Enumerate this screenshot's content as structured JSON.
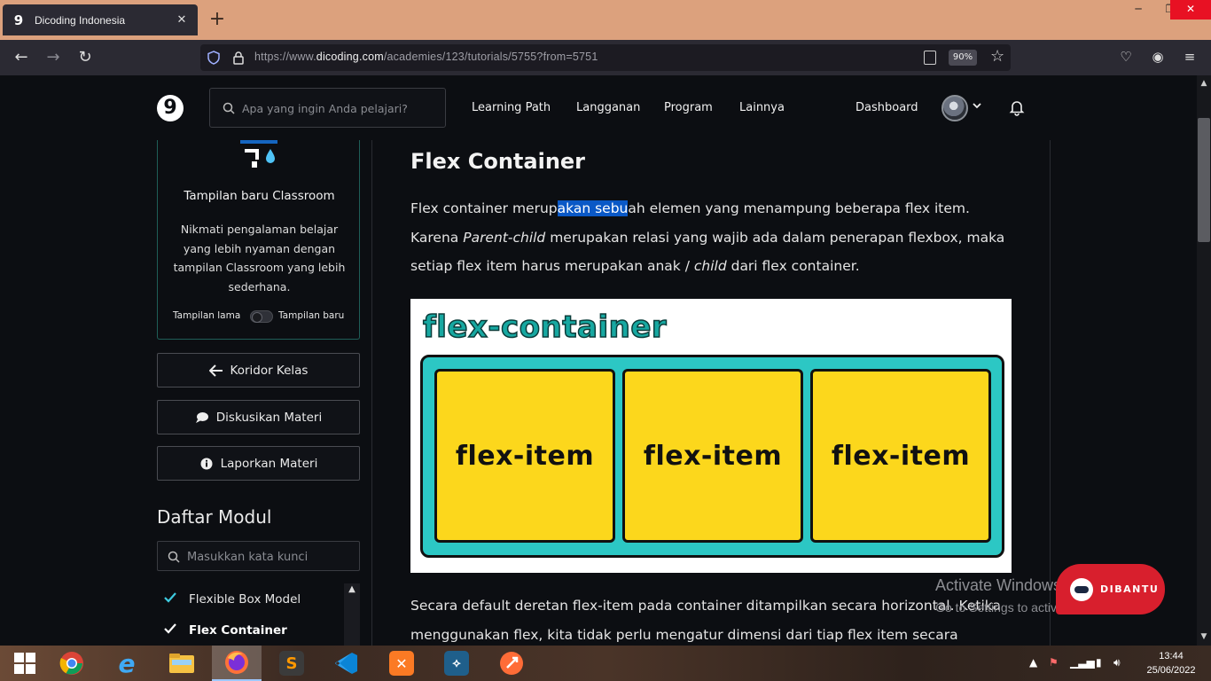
{
  "browser": {
    "tab_title": "Dicoding Indonesia",
    "url_prefix": "https://www.",
    "url_host": "dicoding.com",
    "url_path": "/academies/123/tutorials/5755?from=5751",
    "zoom": "90%",
    "new_tab_symbol": "+",
    "close_symbol": "✕",
    "window_buttons": {
      "minimize": "─",
      "maximize": "❐",
      "close": "✕"
    },
    "icons": [
      "back-arrow-icon",
      "forward-arrow-icon",
      "reload-icon",
      "shield-icon",
      "lock-icon",
      "reader-view-icon",
      "star-icon",
      "pocket-icon",
      "account-icon",
      "menu-icon"
    ]
  },
  "site": {
    "logo": "9",
    "search_placeholder": "Apa yang ingin Anda pelajari?",
    "menu": [
      "Learning Path",
      "Langganan",
      "Program",
      "Lainnya"
    ],
    "dashboard": "Dashboard"
  },
  "sidebar": {
    "promo_title": "Tampilan baru Classroom",
    "promo_desc": "Nikmati pengalaman belajar yang lebih nyaman dengan tampilan Classroom yang lebih sederhana.",
    "toggle_old": "Tampilan lama",
    "toggle_new": "Tampilan baru",
    "toggle_on": false,
    "buttons": [
      "Koridor Kelas",
      "Diskusikan Materi",
      "Laporkan Materi"
    ],
    "modul_title": "Daftar Modul",
    "modul_search_placeholder": "Masukkan kata kunci",
    "modul_items": [
      {
        "label": "Flexible Box Model",
        "done": true,
        "active": false
      },
      {
        "label": "Flex Container",
        "done": true,
        "active": true
      }
    ]
  },
  "content": {
    "title": "Flex Container",
    "p1": {
      "a": "Flex container merup",
      "selected": "akan sebu",
      "b": "ah elemen yang menampung beberapa flex item. Karena ",
      "italic1": "Parent-child",
      "c": " merupakan relasi yang wajib ada dalam penerapan flexbox, maka setiap flex item harus merupakan anak / ",
      "italic2": "child",
      "d": " dari flex container."
    },
    "figure": {
      "heading": "flex-container",
      "items": [
        "flex-item",
        "flex-item",
        "flex-item"
      ]
    },
    "p2": "Secara default deretan flex-item pada container ditampilkan secara horizontal. Ketika menggunakan flex, kita tidak perlu mengatur dimensi dari tiap flex item secara manual"
  },
  "overlay": {
    "activate_title": "Activate Windows",
    "activate_sub": "Go to Settings to activate Windows.",
    "help_button": "DIBANTU"
  },
  "taskbar": {
    "apps": [
      "windows-start",
      "chrome",
      "internet-explorer",
      "file-explorer",
      "firefox",
      "sublime-text",
      "vscode",
      "xampp",
      "mysql-workbench",
      "postman"
    ],
    "time": "13:44",
    "date": "25/06/2022"
  },
  "colors": {
    "accent_teal": "#2cc7c4",
    "item_yellow": "#fcd71c",
    "help_red": "#d81f2d",
    "selection": "#0a58c6"
  }
}
